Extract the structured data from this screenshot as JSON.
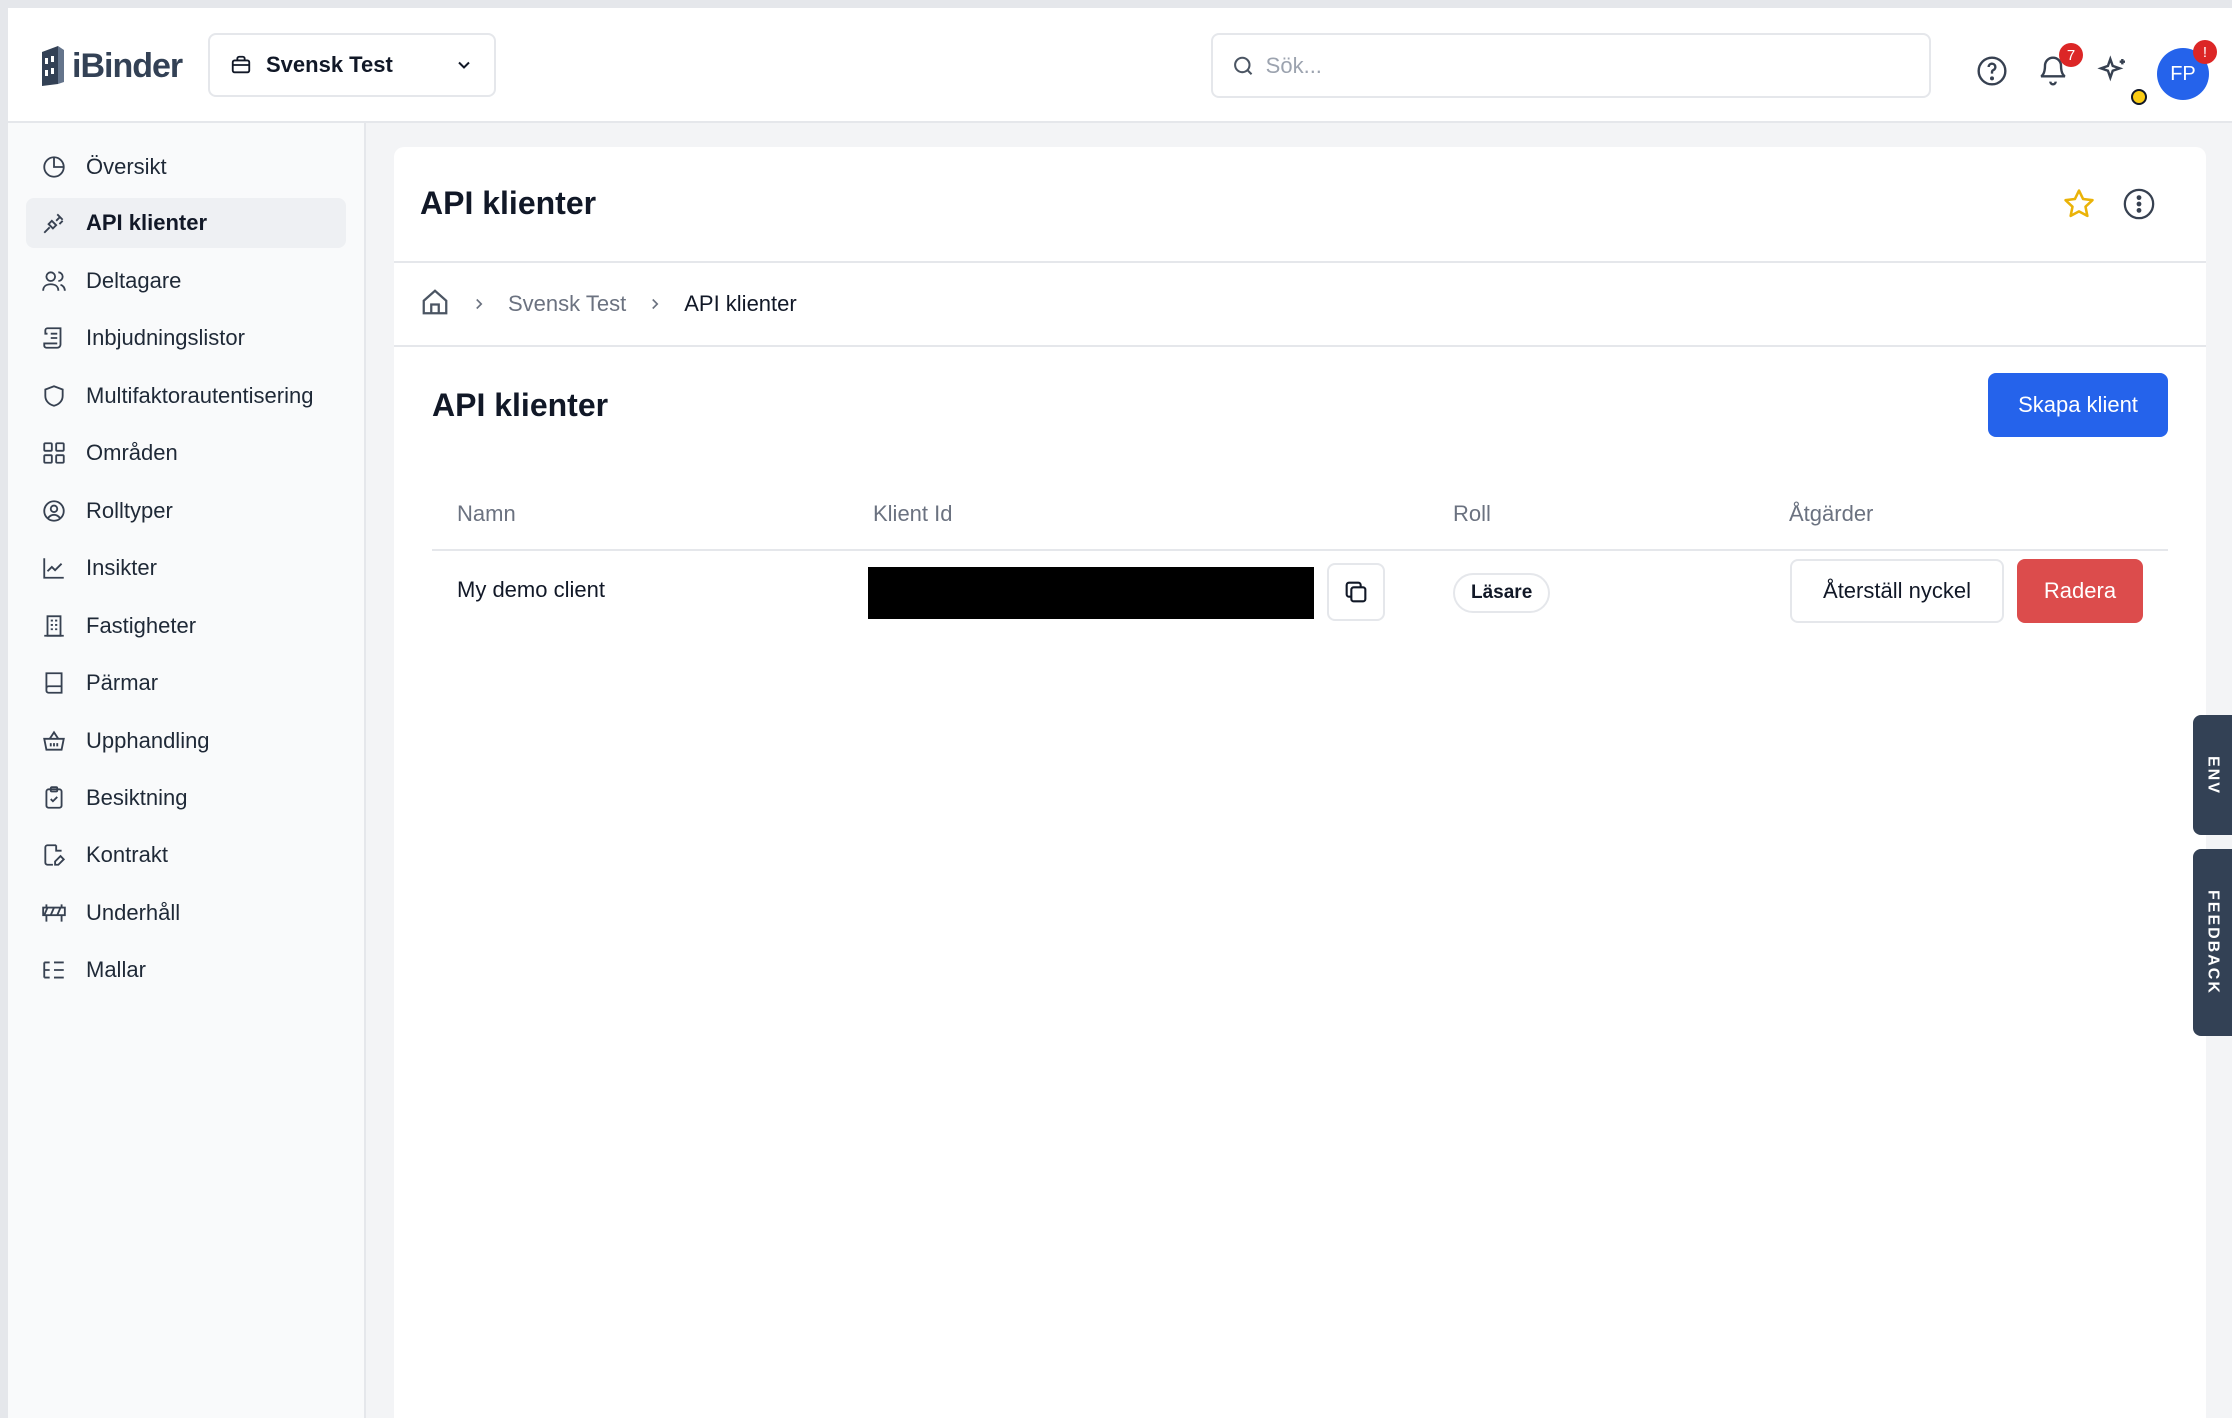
{
  "app": {
    "logo_text": "iBinder",
    "org_selector": "Svensk Test"
  },
  "search": {
    "placeholder": "Sök..."
  },
  "header": {
    "notification_count": "7",
    "avatar_initials": "FP",
    "avatar_badge": "!"
  },
  "sidebar": {
    "items": [
      {
        "label": "Översikt",
        "icon": "pie-chart-icon"
      },
      {
        "label": "API klienter",
        "icon": "plug-icon",
        "active": true
      },
      {
        "label": "Deltagare",
        "icon": "users-icon"
      },
      {
        "label": "Inbjudningslistor",
        "icon": "scroll-icon"
      },
      {
        "label": "Multifaktorautentisering",
        "icon": "shield-icon"
      },
      {
        "label": "Områden",
        "icon": "grid-icon"
      },
      {
        "label": "Rolltyper",
        "icon": "user-circle-icon"
      },
      {
        "label": "Insikter",
        "icon": "line-chart-icon"
      },
      {
        "label": "Fastigheter",
        "icon": "building-icon"
      },
      {
        "label": "Pärmar",
        "icon": "book-icon"
      },
      {
        "label": "Upphandling",
        "icon": "basket-icon"
      },
      {
        "label": "Besiktning",
        "icon": "clipboard-check-icon"
      },
      {
        "label": "Kontrakt",
        "icon": "file-edit-icon"
      },
      {
        "label": "Underhåll",
        "icon": "barrier-icon"
      },
      {
        "label": "Mallar",
        "icon": "list-tree-icon"
      }
    ]
  },
  "page": {
    "title": "API klienter",
    "breadcrumb": {
      "org": "Svensk Test",
      "current": "API klienter"
    },
    "section_title": "API klienter",
    "create_button": "Skapa klient"
  },
  "table": {
    "columns": [
      "Namn",
      "Klient Id",
      "Roll",
      "Åtgärder"
    ],
    "rows": [
      {
        "name": "My demo client",
        "role": "Läsare",
        "reset_label": "Återställ nyckel",
        "delete_label": "Radera"
      }
    ]
  },
  "side_tabs": {
    "env": "ENV",
    "feedback": "FEEDBACK"
  },
  "colors": {
    "primary": "#2563eb",
    "danger": "#dc4c4c",
    "star": "#eab308",
    "side_tab": "#334155"
  }
}
